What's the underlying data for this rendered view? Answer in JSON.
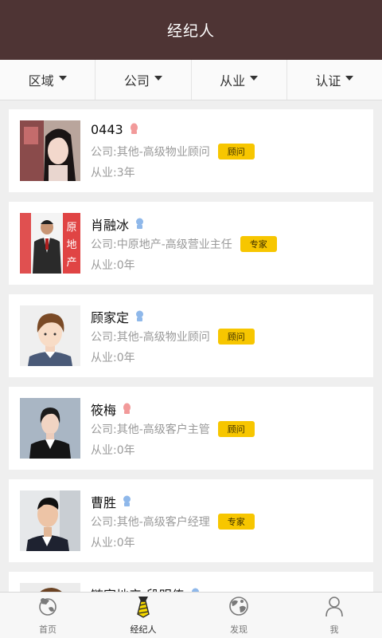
{
  "header": {
    "title": "经纪人"
  },
  "filters": [
    {
      "label": "区域"
    },
    {
      "label": "公司"
    },
    {
      "label": "从业"
    },
    {
      "label": "认证"
    }
  ],
  "agents": [
    {
      "name": "0443",
      "gender": "female",
      "company": "公司:其他-高级物业顾问",
      "badge": "顾问",
      "years": "从业:3年"
    },
    {
      "name": "肖融冰",
      "gender": "male",
      "company": "公司:中原地产-高级营业主任",
      "badge": "专家",
      "years": "从业:0年"
    },
    {
      "name": "顾家定",
      "gender": "male",
      "company": "公司:其他-高级物业顾问",
      "badge": "顾问",
      "years": "从业:0年"
    },
    {
      "name": "筱梅",
      "gender": "female",
      "company": "公司:其他-高级客户主管",
      "badge": "顾问",
      "years": "从业:0年"
    },
    {
      "name": "曹胜",
      "gender": "male",
      "company": "公司:其他-高级客户经理",
      "badge": "专家",
      "years": "从业:0年"
    },
    {
      "name": "链家地产-段明传",
      "gender": "male",
      "company": "",
      "badge": "",
      "years": ""
    }
  ],
  "tabs": [
    {
      "label": "首页",
      "icon": "home-icon"
    },
    {
      "label": "经纪人",
      "icon": "tie-icon"
    },
    {
      "label": "发现",
      "icon": "discover-icon"
    },
    {
      "label": "我",
      "icon": "person-icon"
    }
  ],
  "colors": {
    "header_bg": "#4e3434",
    "badge_bg": "#f7c600",
    "female": "#f29a9a",
    "male": "#8fb8ea",
    "tie_yellow": "#f5d700"
  }
}
